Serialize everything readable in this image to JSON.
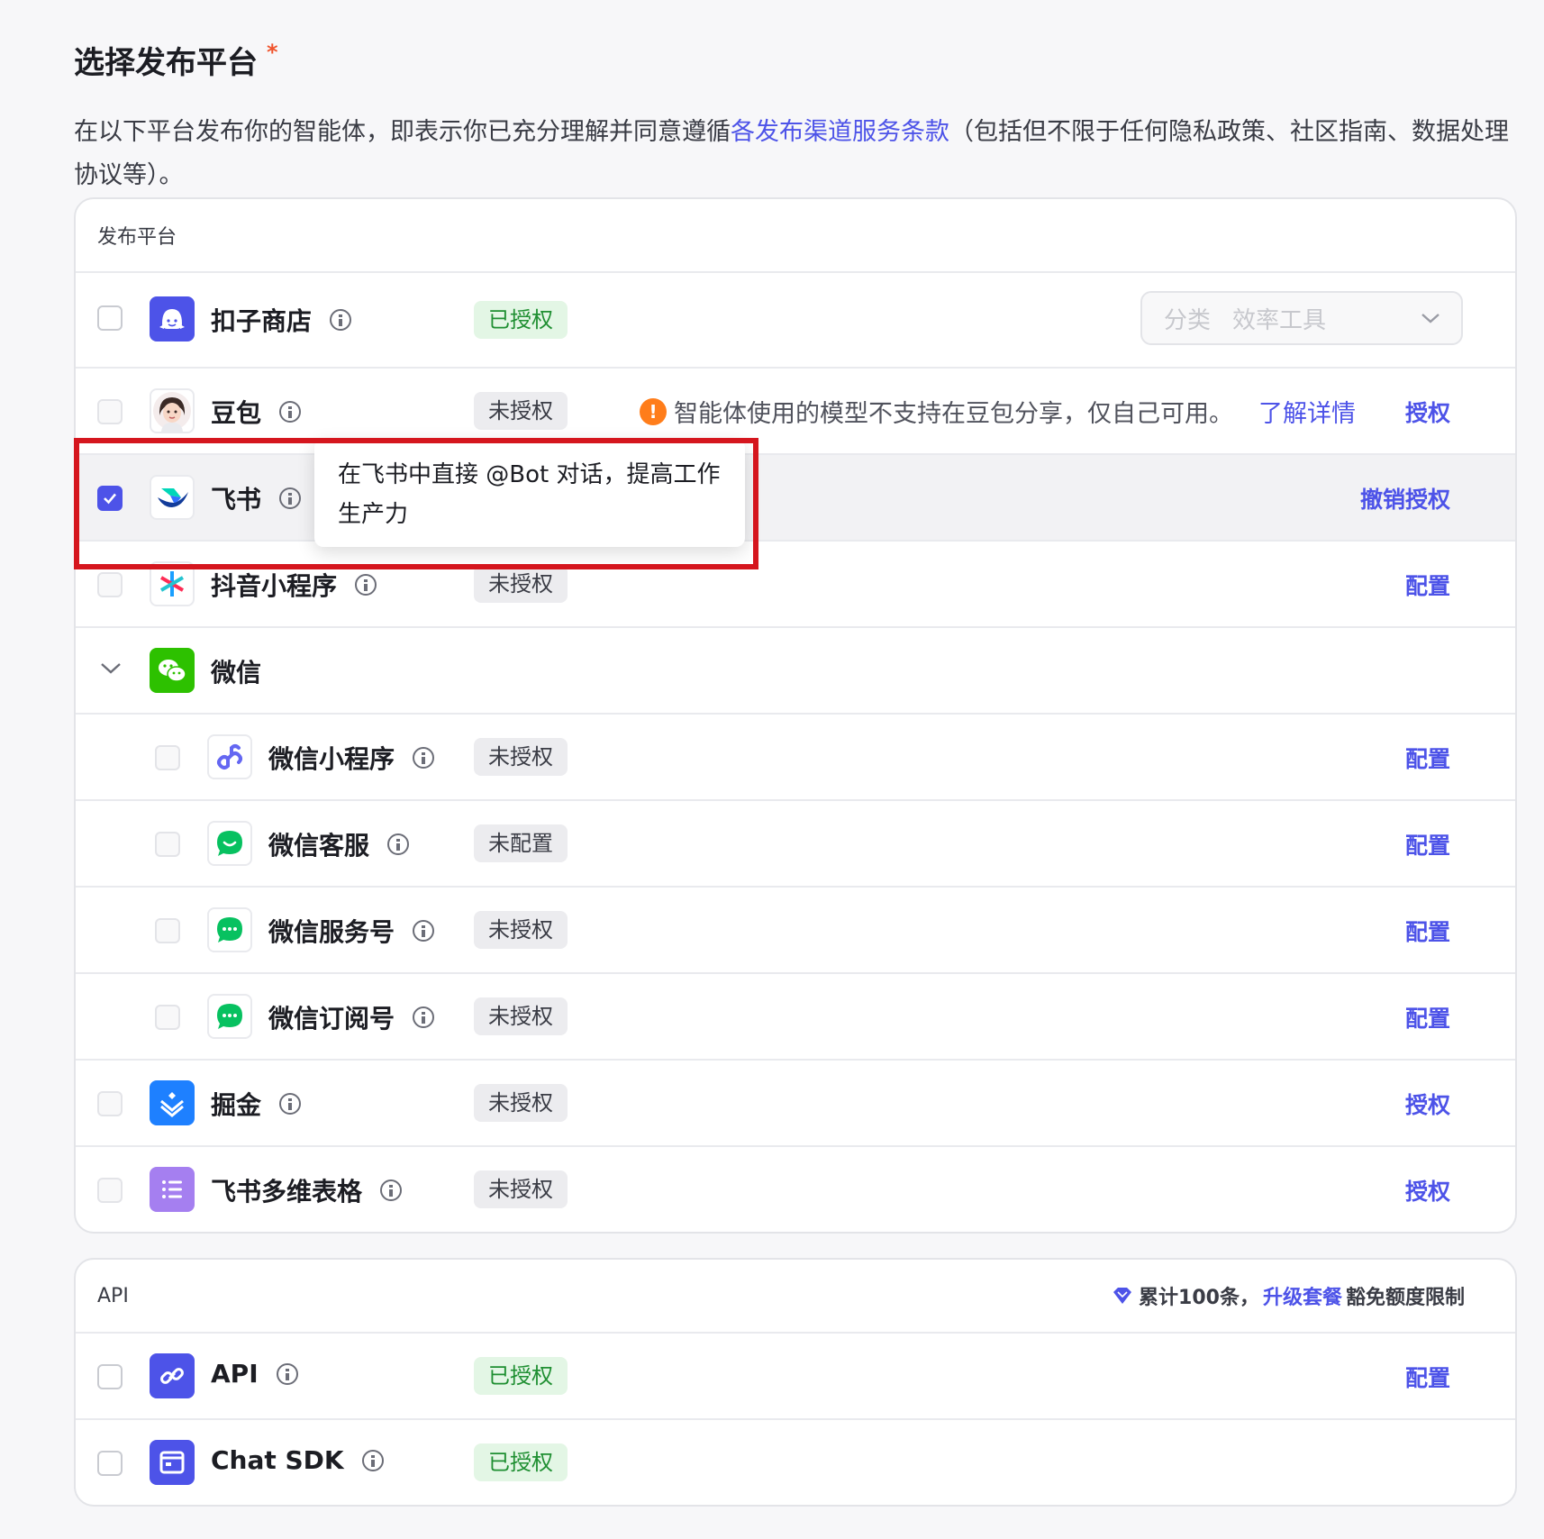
{
  "header": {
    "title": "选择发布平台",
    "required_mark": "*",
    "description_before": "在以下平台发布你的智能体，即表示你已充分理解并同意遵循",
    "description_link": "各发布渠道服务条款",
    "description_after": "（包括但不限于任何隐私政策、社区指南、数据处理协议等）。"
  },
  "platforms": {
    "header": "发布平台",
    "rows": [
      {
        "name": "扣子商店",
        "badge": "已授权",
        "category_label": "分类",
        "category_value": "效率工具"
      },
      {
        "name": "豆包",
        "badge": "未授权",
        "warning": "智能体使用的模型不支持在豆包分享，仅自己可用。",
        "warning_link": "了解详情",
        "action": "授权"
      },
      {
        "name": "飞书",
        "action": "撤销授权",
        "tooltip": "在飞书中直接 @Bot 对话，提高工作生产力"
      },
      {
        "name": "抖音小程序",
        "badge": "未授权",
        "action": "配置"
      },
      {
        "name": "微信"
      },
      {
        "name": "微信小程序",
        "badge": "未授权",
        "action": "配置"
      },
      {
        "name": "微信客服",
        "badge": "未配置",
        "action": "配置"
      },
      {
        "name": "微信服务号",
        "badge": "未授权",
        "action": "配置"
      },
      {
        "name": "微信订阅号",
        "badge": "未授权",
        "action": "配置"
      },
      {
        "name": "掘金",
        "badge": "未授权",
        "action": "授权"
      },
      {
        "name": "飞书多维表格",
        "badge": "未授权",
        "action": "授权"
      }
    ]
  },
  "api": {
    "header": "API",
    "quota_text": "累计100条，",
    "upgrade_link": "升级套餐",
    "quota_after": "豁免额度限制",
    "rows": [
      {
        "name": "API",
        "badge": "已授权",
        "action": "配置"
      },
      {
        "name": "Chat SDK",
        "badge": "已授权"
      }
    ]
  },
  "icons": {
    "info": "info-icon",
    "checkbox_checked": "check-icon",
    "expand": "chevron-down-icon",
    "warning": "exclamation-icon",
    "diamond": "diamond-icon"
  },
  "colors": {
    "accent": "#4d53e8",
    "authorized_bg": "#e3f6e5",
    "authorized_text": "#1f8f32",
    "warning": "#ff7d1a",
    "highlight_box": "#d5161e"
  }
}
